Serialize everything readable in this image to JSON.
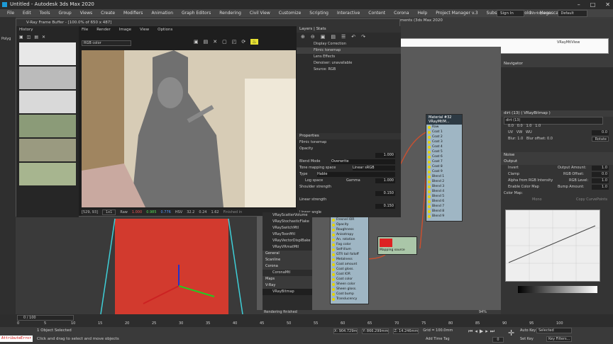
{
  "app": {
    "title": "Untitled - Autodesk 3ds Max 2020",
    "subtitle_badge": "ments (3ds Max 2020"
  },
  "menu": [
    "File",
    "Edit",
    "Tools",
    "Group",
    "Views",
    "Create",
    "Modifiers",
    "Animation",
    "Graph Editors",
    "Rendering",
    "Civil View",
    "Customize",
    "Scripting",
    "Interactive",
    "Content",
    "Corona",
    "Help",
    "Project Manager v.3",
    "Substance",
    "Arnold",
    "Megascans"
  ],
  "account": {
    "signin": "Sign In",
    "workspaces_label": "Workspaces:",
    "workspace": "Default"
  },
  "left_tab": "Polyg",
  "vfb": {
    "title": "V-Ray Frame Buffer - [100.0% of 650 x 487]",
    "history_label": "History",
    "menu": [
      "File",
      "Render",
      "Image",
      "View",
      "Options"
    ],
    "channel": "RGB color",
    "coords": "[529, 93]",
    "mode": "1x1",
    "raw_label": "Raw",
    "r": "1.000",
    "g": "0.985",
    "b": "0.776",
    "space": "HSV",
    "h": "32.2",
    "s": "0.24",
    "v": "1.62",
    "finished": "Finished in"
  },
  "layers": {
    "tab1": "Layers",
    "tab2": "Stats",
    "items": [
      "Display Correction",
      "Filmic tonemap",
      "Lens Effects",
      "Denoiser: unavailable",
      "Source: RGB"
    ]
  },
  "props": {
    "header": "Properties",
    "name": "Filmic tonemap",
    "opacity_label": "Opacity",
    "opacity": "1.000",
    "blend_label": "Blend Mode",
    "blend": "Overwrite",
    "tonemap_label": "Tone mapping space",
    "tonemap": "Linear sRGB",
    "type_label": "Type",
    "type": "Hable",
    "logspace": "Log space",
    "gamma_label": "Gamma",
    "gamma": "1.000",
    "shoulder_label": "Shoulder strength",
    "shoulder": "0.150",
    "linear_label": "Linear strength",
    "linear": "0.150",
    "linear_angle": "Linear angle"
  },
  "rightwin": {
    "title": "VRayMtlView"
  },
  "navigator": "Navigator",
  "bitmap": {
    "title": "dirt (13) ( VRayBitmap )",
    "name": "dirt (13)",
    "u": "0.0",
    "v": "0.0",
    "ul": "1.0",
    "vl": "1.0",
    "w": "0.0",
    "blur": "1.0",
    "blur_offset": "0.0",
    "rotate": "Rotate",
    "uv": "UV",
    "vw": "VW",
    "wu": "WU",
    "noise": "Noise",
    "output": "Output",
    "invert": "Invert",
    "clamp": "Clamp",
    "alpha_intensity": "Alpha from RGB Intensity",
    "color_map": "Enable Color Map",
    "out_amount": "Output Amount:",
    "out_amount_v": "1.0",
    "rgb_offset": "RGB Offset:",
    "rgb_offset_v": "0.0",
    "rgb_level": "RGB Level:",
    "rgb_level_v": "1.0",
    "bump_amount": "Bump Amount:",
    "bump_amount_v": "1.0",
    "colormap_label": "Color Map:",
    "mono": "Mono",
    "copy_points": "Copy CurvePoints"
  },
  "material_node": {
    "title": "Material #32",
    "subtitle": "VRayMtlM...",
    "slots": [
      "Raw",
      "Coat 1",
      "Coat 2",
      "Coat 3",
      "Coat 4",
      "Coat 5",
      "Coat 6",
      "Coat 7",
      "Coat 8",
      "Coat 9",
      "Blend 1",
      "Blend 2",
      "Blend 3",
      "Blend 4",
      "Blend 5",
      "Blend 6",
      "Blend 7",
      "Blend 8",
      "Blend 9"
    ]
  },
  "vray_node": {
    "slots": [
      "Fresnel IOR",
      "Opacity",
      "Roughness",
      "Anisotropy",
      "An. rotation",
      "Fog color",
      "Self-illum",
      "GTR tail falloff",
      "Metalness",
      "Coat amount",
      "Coat gloss.",
      "Coat IOR",
      "Coat color",
      "Sheen color",
      "Sheen gloss.",
      "Coat bump",
      "Translucency"
    ]
  },
  "bitmap_node": {
    "label": "Mapping source"
  },
  "browser": {
    "items": [
      "VRayScatterVolume",
      "VRayStochasticFlake",
      "VRaySwitchMtl",
      "VRayToonMtl",
      "VRayVectorDisplBake",
      "VRayVRmatMtl"
    ],
    "general": "General",
    "scanline": "Scanline",
    "corona": "Corona",
    "coronamtl": "CoronaMtl",
    "maps": "Maps",
    "vray": "V-Ray",
    "vraybitmap": "VRayBitmap",
    "rendering": "Rendering finished",
    "zoom": "94%"
  },
  "timeline": {
    "frame": "0 / 100",
    "ticks": [
      "0",
      "5",
      "10",
      "15",
      "20",
      "25",
      "30",
      "35",
      "40",
      "45",
      "50",
      "55",
      "60",
      "65",
      "70",
      "75",
      "80",
      "85",
      "90",
      "95",
      "100"
    ]
  },
  "status": {
    "selected": "1 Object Selected",
    "hint": "Click and drag to select and move objects",
    "script": "AttributeError",
    "x": "X: 904.729m",
    "y": "Y: 866.299mm",
    "z": "Z: 14.246mm",
    "grid": "Grid = 100.0mm",
    "addtag": "Add Time Tag",
    "autokey": "Auto Key",
    "selected_dd": "Selected",
    "setkey": "Set Key",
    "keyfilters": "Key Filters...",
    "frame": "0"
  }
}
